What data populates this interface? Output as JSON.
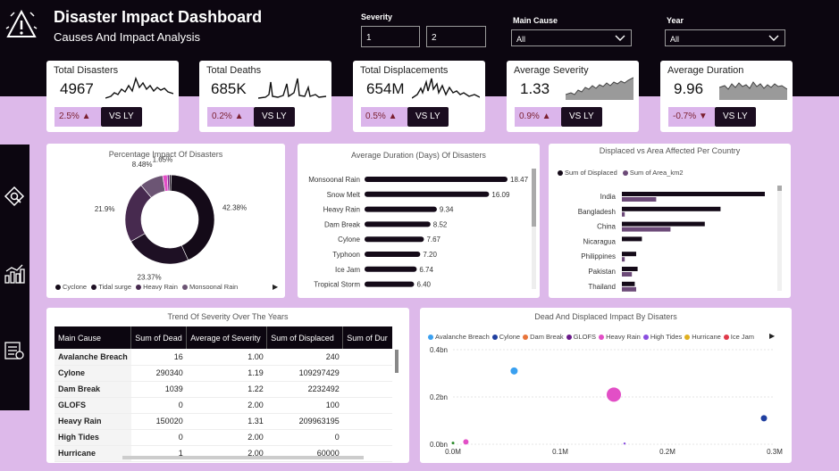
{
  "header": {
    "title": "Disaster Impact Dashboard",
    "subtitle": "Causes And Impact Analysis"
  },
  "filters": {
    "severity_label": "Severity",
    "severity_min": "1",
    "severity_max": "2",
    "main_cause_label": "Main Cause",
    "main_cause_value": "All",
    "year_label": "Year",
    "year_value": "All"
  },
  "kpis": [
    {
      "label": "Total Disasters",
      "value": "4967",
      "change": "2.5%",
      "direction": "up",
      "vs": "VS LY"
    },
    {
      "label": "Total Deaths",
      "value": "685K",
      "change": "0.2%",
      "direction": "up",
      "vs": "VS LY"
    },
    {
      "label": "Total Displacements",
      "value": "654M",
      "change": "0.5%",
      "direction": "up",
      "vs": "VS LY"
    },
    {
      "label": "Average Severity",
      "value": "1.33",
      "change": "0.9%",
      "direction": "up",
      "vs": "VS LY"
    },
    {
      "label": "Average Duration",
      "value": "9.96",
      "change": "-0.7%",
      "direction": "down",
      "vs": "VS LY"
    }
  ],
  "sidebar": {
    "icons": [
      "disaster-icon",
      "analytics-icon",
      "report-icon"
    ]
  },
  "colors": {
    "dark": "#0c0610",
    "accent": "#4a2350",
    "lavender": "#ddb9ea",
    "up": "#7a1f2f"
  },
  "chart_data": [
    {
      "type": "pie",
      "title": "Percentage Impact Of Disasters",
      "slices": [
        {
          "label": "Cyclone",
          "value": 42.38,
          "display": "42.38%",
          "color": "#140a18"
        },
        {
          "label": "Tidal surge",
          "value": 23.37,
          "display": "23.37%",
          "color": "#1e1024"
        },
        {
          "label": "Heavy Rain",
          "value": 21.9,
          "display": "21.9%",
          "color": "#472a4f"
        },
        {
          "label": "Monsoonal Rain",
          "value": 8.48,
          "display": "8.48%",
          "color": "#6c5574"
        },
        {
          "label": "",
          "value": 1.65,
          "display": "1.65%",
          "color": "#e24fc6"
        },
        {
          "label": "",
          "value": 0.8,
          "display": "",
          "color": "#7a1f8a"
        },
        {
          "label": "",
          "value": 0.6,
          "display": "",
          "color": "#140a18"
        }
      ],
      "legend": [
        "Cyclone",
        "Tidal surge",
        "Heavy Rain",
        "Monsoonal Rain"
      ]
    },
    {
      "type": "bar",
      "orientation": "horizontal",
      "title": "Average Duration (Days) Of Disasters",
      "categories": [
        "Monsoonal Rain",
        "Snow Melt",
        "Heavy Rain",
        "Dam Break",
        "Cylone",
        "Typhoon",
        "Ice Jam",
        "Tropical Storm"
      ],
      "values": [
        18.47,
        16.09,
        9.34,
        8.52,
        7.67,
        7.2,
        6.74,
        6.4
      ],
      "labels": [
        "18.47",
        "16.09",
        "9.34",
        "8.52",
        "7.67",
        "7.20",
        "6.74",
        "6.40"
      ]
    },
    {
      "type": "bar",
      "orientation": "horizontal",
      "title": "Displaced vs Area Affected Per Country",
      "categories": [
        "India",
        "Bangladesh",
        "China",
        "Nicaragua",
        "Philippines",
        "Pakistan",
        "Thailand"
      ],
      "series": [
        {
          "name": "Sum of Displaced",
          "color": "#140a18",
          "values": [
            1.0,
            0.69,
            0.58,
            0.14,
            0.1,
            0.11,
            0.09
          ]
        },
        {
          "name": "Sum of Area_km2",
          "color": "#6c4a78",
          "values": [
            0.24,
            0.02,
            0.34,
            0.0,
            0.02,
            0.07,
            0.1
          ]
        }
      ]
    },
    {
      "type": "table",
      "title": "Trend Of Severity Over The Years",
      "columns": [
        "Main Cause",
        "Sum of Dead",
        "Average of Severity",
        "Sum of Displaced",
        "Sum of Dur"
      ],
      "rows": [
        [
          "Avalanche Breach",
          "16",
          "1.00",
          "240",
          ""
        ],
        [
          "Cylone",
          "290340",
          "1.19",
          "109297429",
          ""
        ],
        [
          "Dam Break",
          "1039",
          "1.22",
          "2232492",
          ""
        ],
        [
          "GLOFS",
          "0",
          "2.00",
          "100",
          ""
        ],
        [
          "Heavy Rain",
          "150020",
          "1.31",
          "209963195",
          ""
        ],
        [
          "High Tides",
          "0",
          "2.00",
          "0",
          ""
        ],
        [
          "Hurricane",
          "1",
          "2.00",
          "60000",
          ""
        ]
      ]
    },
    {
      "type": "scatter",
      "title": "Dead And Displaced Impact By Disaters",
      "legend": [
        {
          "name": "Avalanche Breach",
          "color": "#3aa0f0"
        },
        {
          "name": "Cylone",
          "color": "#1f3fa0"
        },
        {
          "name": "Dam Break",
          "color": "#e8743a"
        },
        {
          "name": "GLOFS",
          "color": "#6a1a8a"
        },
        {
          "name": "Heavy Rain",
          "color": "#e24fc6"
        },
        {
          "name": "High Tides",
          "color": "#8a4fe0"
        },
        {
          "name": "Hurricane",
          "color": "#e0b020"
        },
        {
          "name": "Ice Jam",
          "color": "#e03a4a"
        }
      ],
      "xticks": [
        "0.0M",
        "0.1M",
        "0.2M",
        "0.3M"
      ],
      "yticks": [
        "0.0bn",
        "0.2bn",
        "0.4bn"
      ],
      "xlim": [
        0,
        0.3
      ],
      "ylim": [
        0,
        0.4
      ],
      "points": [
        {
          "series": "Avalanche Breach",
          "x": 0.057,
          "y": 0.31,
          "r": 4,
          "color": "#3aa0f0"
        },
        {
          "series": "Heavy Rain",
          "x": 0.15,
          "y": 0.21,
          "r": 8,
          "color": "#e24fc6"
        },
        {
          "series": "Cylone",
          "x": 0.29,
          "y": 0.11,
          "r": 3.5,
          "color": "#1f3fa0"
        },
        {
          "series": "Heavy Rain",
          "x": 0.012,
          "y": 0.01,
          "r": 3,
          "color": "#e24fc6"
        },
        {
          "series": "GLOFS",
          "x": 0.0,
          "y": 0.005,
          "r": 1.5,
          "color": "#2a8a2a"
        },
        {
          "series": "High Tides",
          "x": 0.16,
          "y": 0.003,
          "r": 1.2,
          "color": "#8a4fe0"
        }
      ]
    }
  ]
}
